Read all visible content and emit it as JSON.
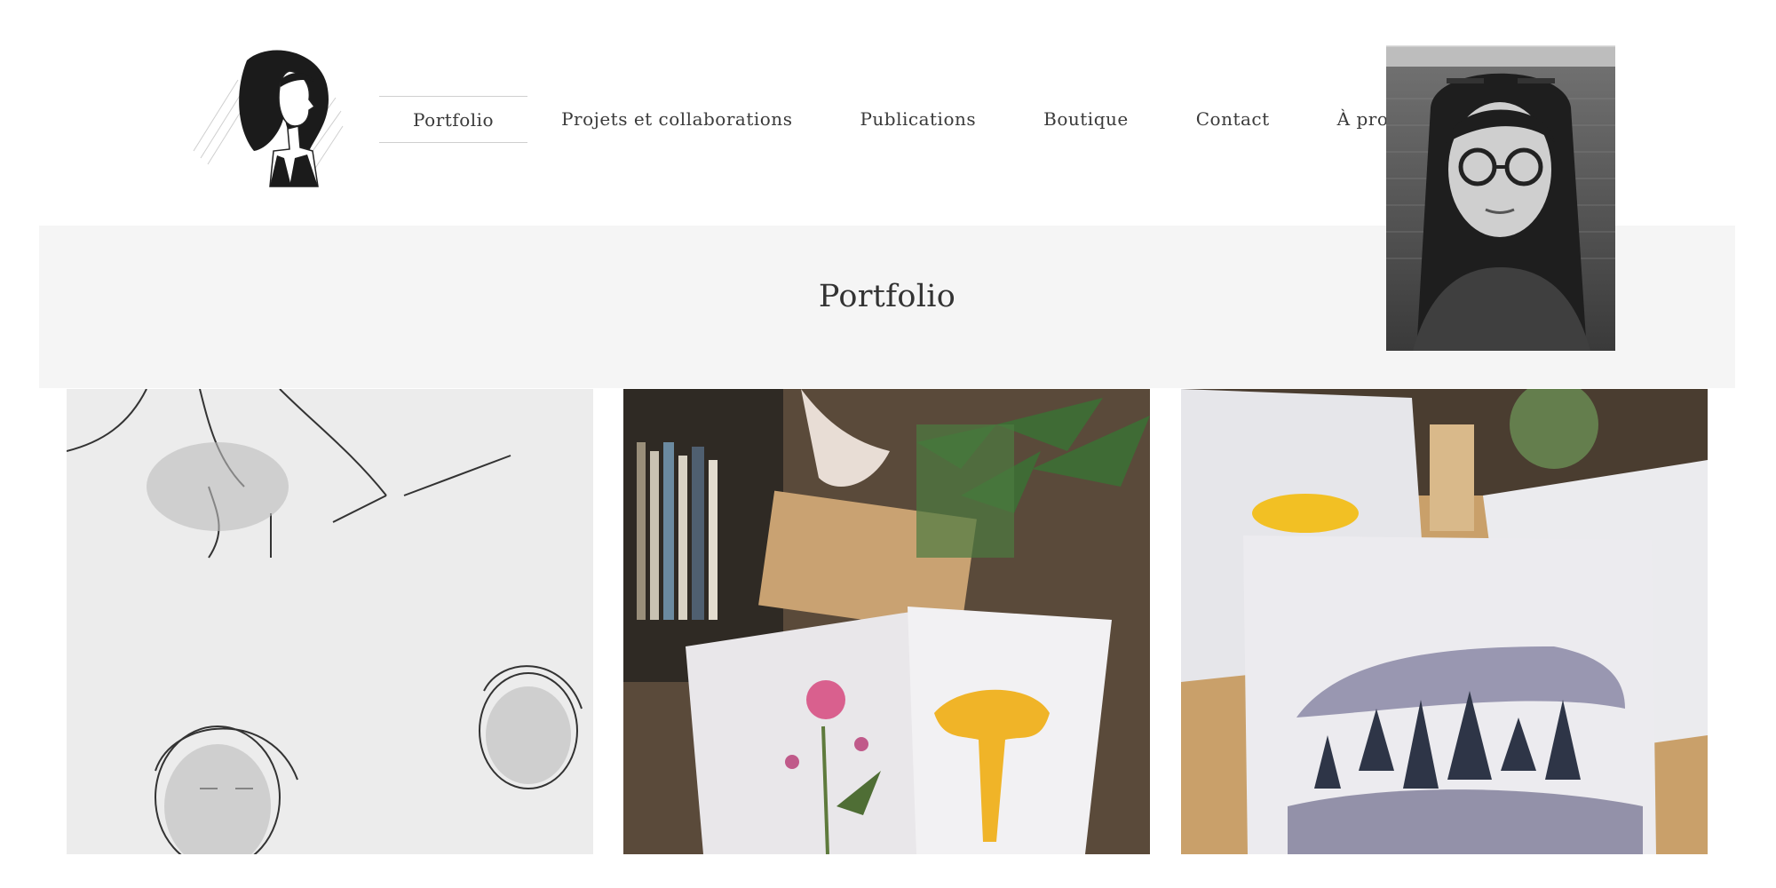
{
  "nav": {
    "items": [
      {
        "label": "Portfolio",
        "active": true
      },
      {
        "label": "Projets et collaborations",
        "active": false
      },
      {
        "label": "Publications",
        "active": false
      },
      {
        "label": "Boutique",
        "active": false
      },
      {
        "label": "Contact",
        "active": false
      },
      {
        "label": "À propos",
        "active": false
      }
    ]
  },
  "banner": {
    "title": "Portfolio"
  },
  "images": {
    "logo": "illustrated-self-portrait-logo",
    "profile": "profile-photo-black-and-white",
    "tiles": [
      "sketchbook-drawing",
      "illustrated-cards-on-table",
      "watercolor-forest-card"
    ]
  }
}
